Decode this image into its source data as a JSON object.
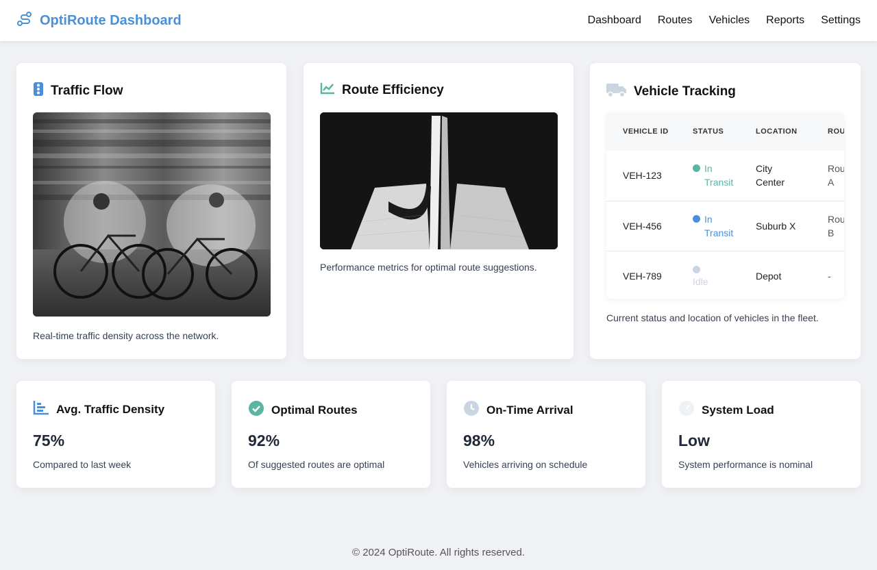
{
  "app": {
    "title": "OptiRoute Dashboard",
    "logo_icon": "route-icon",
    "accent_color": "#4a90d9"
  },
  "nav": {
    "items": [
      {
        "label": "Dashboard"
      },
      {
        "label": "Routes"
      },
      {
        "label": "Vehicles"
      },
      {
        "label": "Reports"
      },
      {
        "label": "Settings"
      }
    ]
  },
  "cards": {
    "traffic_flow": {
      "title": "Traffic Flow",
      "icon": "traffic-light-icon",
      "description": "Real-time traffic density across the network."
    },
    "route_efficiency": {
      "title": "Route Efficiency",
      "icon": "line-chart-icon",
      "description": "Performance metrics for optimal route suggestions."
    },
    "vehicle_tracking": {
      "title": "Vehicle Tracking",
      "icon": "truck-icon",
      "description": "Current status and location of vehicles in the fleet.",
      "columns": [
        "VEHICLE ID",
        "STATUS",
        "LOCATION",
        "ROUTE"
      ],
      "rows": [
        {
          "id": "VEH-123",
          "status": "In Transit",
          "status_color": "#5bb5a2",
          "location": "City Center",
          "route": "Route A"
        },
        {
          "id": "VEH-456",
          "status": "In Transit",
          "status_color": "#4a90d9",
          "location": "Suburb X",
          "route": "Route B"
        },
        {
          "id": "VEH-789",
          "status": "Idle",
          "status_color": "#cbd5e1",
          "location": "Depot",
          "route": "-"
        }
      ]
    }
  },
  "metrics": [
    {
      "title": "Avg. Traffic Density",
      "icon": "bar-chart-icon",
      "icon_color": "#4a90d9",
      "value": "75%",
      "subtitle": "Compared to last week"
    },
    {
      "title": "Optimal Routes",
      "icon": "check-circle-icon",
      "icon_color": "#5bb5a2",
      "value": "92%",
      "subtitle": "Of suggested routes are optimal"
    },
    {
      "title": "On-Time Arrival",
      "icon": "clock-icon",
      "icon_color": "#cbd5e1",
      "value": "98%",
      "subtitle": "Vehicles arriving on schedule"
    },
    {
      "title": "System Load",
      "icon": "gauge-icon",
      "icon_color": "#eef1f5",
      "value": "Low",
      "subtitle": "System performance is nominal"
    }
  ],
  "footer": {
    "text": "© 2024 OptiRoute. All rights reserved."
  }
}
